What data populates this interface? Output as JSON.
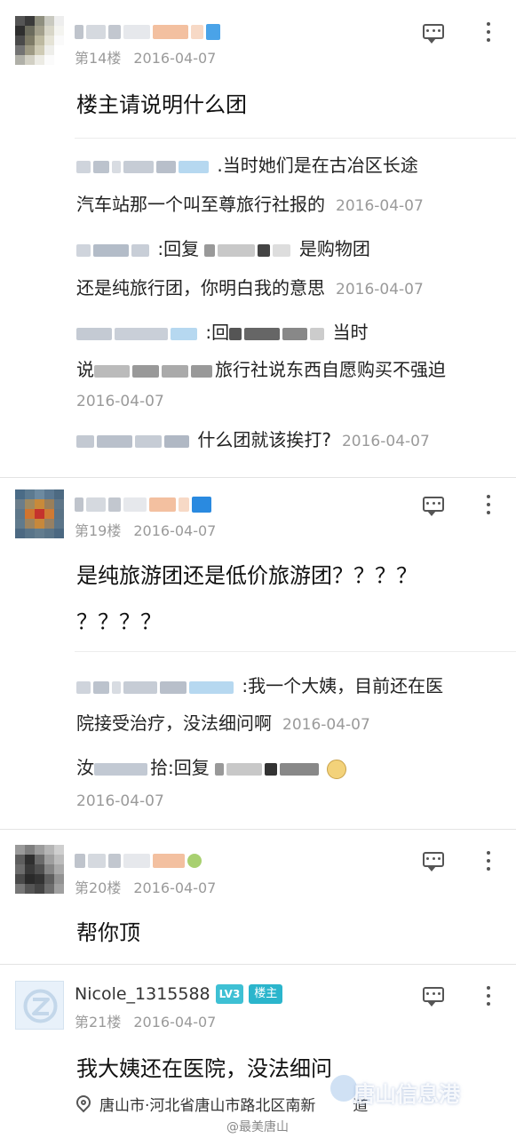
{
  "colors": {
    "accent": "#3ec0d4",
    "meta_text": "#9a9a9a",
    "divider": "#e3e3e3"
  },
  "posts": [
    {
      "floor": "第14楼",
      "date": "2016-04-07",
      "content": "楼主请说明什么团",
      "replies": [
        {
          "line1": ".当时她们是在古冶区长途",
          "line2": "汽车站那一个叫至尊旅行社报的",
          "date": "2016-04-07"
        },
        {
          "prefix": ":回复 ",
          "suffix": "是购物团",
          "line2": "还是纯旅行团，你明白我的意思",
          "date": "2016-04-07"
        },
        {
          "prefix": ":回",
          "suffix": "当时",
          "line2_a": "说",
          "line2_b": "旅行社说东西自愿购买不强迫",
          "date": "2016-04-07"
        },
        {
          "text": "什么团就该挨打?",
          "date": "2016-04-07"
        }
      ]
    },
    {
      "floor": "第19楼",
      "date": "2016-04-07",
      "content_line1": "是纯旅游团还是低价旅游团？？？？",
      "content_line2": "？？？？",
      "replies": [
        {
          "line1": ":我一个大姨，目前还在医",
          "line2": "院接受治疗，没法细问啊",
          "date": "2016-04-07"
        },
        {
          "prefix": "汝",
          "prefix2": "拾:回复 ",
          "date": "2016-04-07"
        }
      ]
    },
    {
      "floor": "第20楼",
      "date": "2016-04-07",
      "content": "帮你顶"
    },
    {
      "username": "Nicole_1315588",
      "level": "LV3",
      "op_badge": "楼主",
      "floor": "第21楼",
      "date": "2016-04-07",
      "content": "我大姨还在医院，没法细问",
      "location": "唐山市·河北省唐山市路北区南新",
      "location_tail": "道"
    }
  ],
  "icons": {
    "message": "message-icon",
    "more": "more-icon",
    "location": "location-pin-icon"
  },
  "watermark": {
    "brand": "唐山信息港",
    "weibo": "@最美唐山"
  }
}
